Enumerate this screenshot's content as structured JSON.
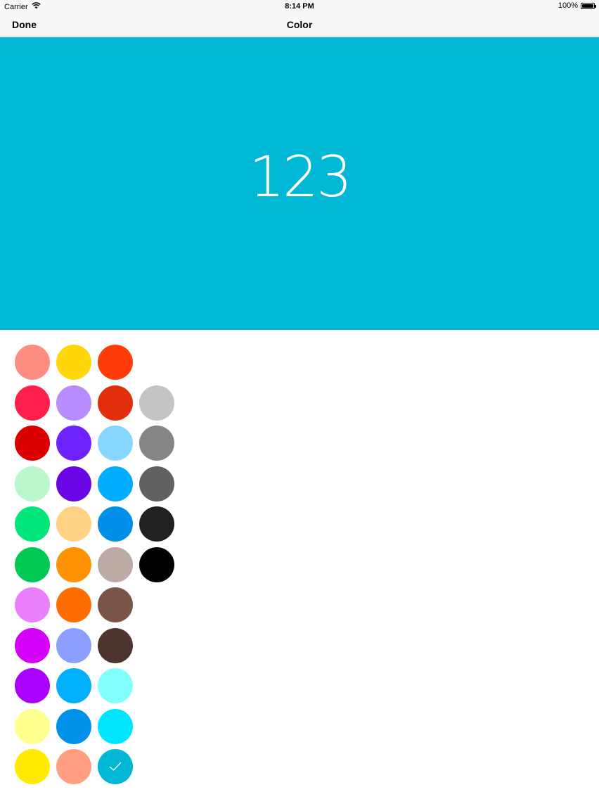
{
  "status_bar": {
    "carrier": "Carrier",
    "time": "8:14 PM",
    "battery_text": "100%",
    "battery_level": 1.0
  },
  "nav": {
    "done_label": "Done",
    "title": "Color"
  },
  "preview": {
    "number": "123",
    "background_color": "#00b8d6"
  },
  "palette": {
    "selected_color": "#00b8d6",
    "rows": [
      [
        "#ff8c81",
        "#ffd60a",
        "#ff3b0a"
      ],
      [
        "#ff1f4d",
        "#b68cff",
        "#e02f0a",
        "#c4c3c6"
      ],
      [
        "#db0000",
        "#6e22ff",
        "#87d6ff",
        "#858487"
      ],
      [
        "#b9f6ca",
        "#6a06e6",
        "#00adff",
        "#616161"
      ],
      [
        "#00e67a",
        "#ffd284",
        "#008fe8",
        "#212121"
      ],
      [
        "#00c853",
        "#ff9104",
        "#bcaaa4",
        "#000000"
      ],
      [
        "#ea80fc",
        "#ff6d00",
        "#7a5548",
        null
      ],
      [
        "#d500f9",
        "#8c9eff",
        "#4e342e",
        null
      ],
      [
        "#aa00ff",
        "#00b0ff",
        "#84ffff",
        null
      ],
      [
        "#ffff8d",
        "#0091ea",
        "#00e5ff",
        null
      ],
      [
        "#ffea00",
        "#ff9e80",
        "#00b8d6",
        null
      ]
    ]
  }
}
